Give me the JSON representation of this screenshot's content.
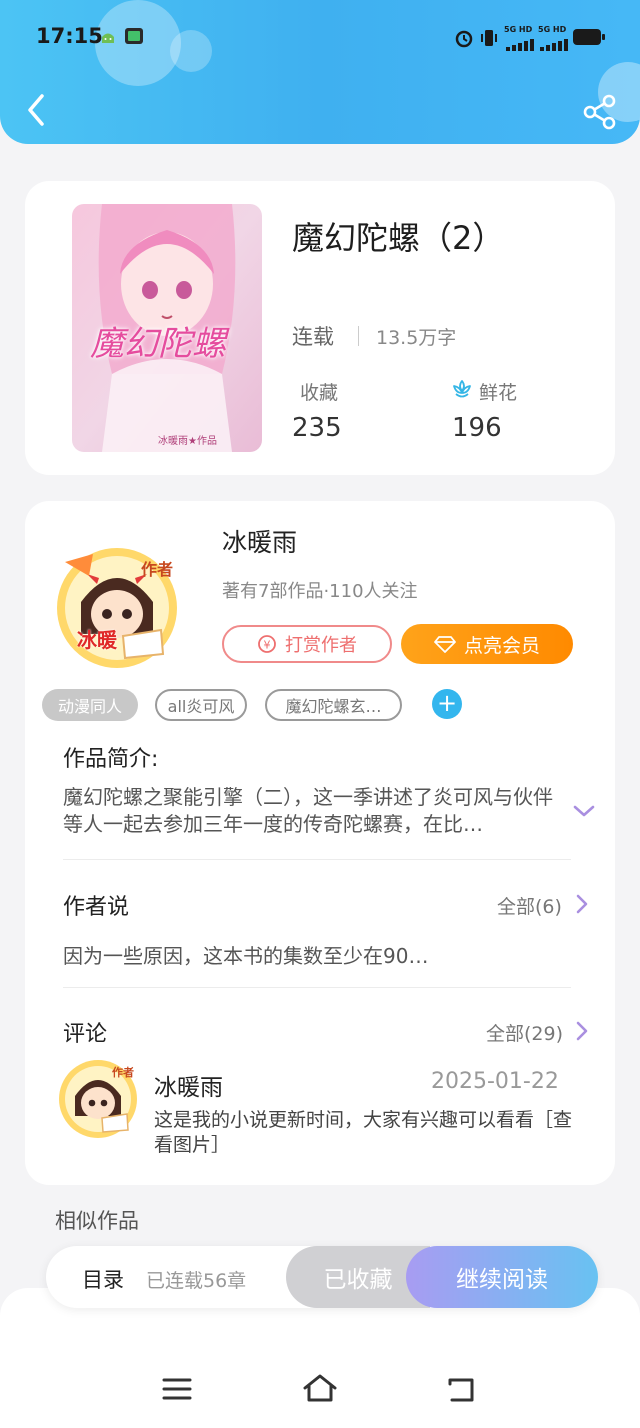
{
  "status_bar": {
    "time": "17:15",
    "net1": "5G HD",
    "net2": "5G HD"
  },
  "header": {
    "back_icon": "chevron-left-icon",
    "share_icon": "share-icon"
  },
  "book": {
    "title": "魔幻陀螺（2）",
    "status": "连载",
    "word_count": "13.5万字",
    "favorites_label": "收藏",
    "favorites_value": "235",
    "flowers_label": "鲜花",
    "flowers_value": "196",
    "cover_title": "魔幻陀螺",
    "cover_credit": "冰暖雨★作品"
  },
  "author": {
    "name": "冰暖雨",
    "meta": "著有7部作品·110人关注",
    "badge": "作者",
    "badge_name": "冰暖",
    "reward_label": "打赏作者",
    "vip_label": "点亮会员",
    "tags": [
      "动漫同人",
      "all炎可风",
      "魔幻陀螺玄…"
    ]
  },
  "intro": {
    "title": "作品简介:",
    "text": "魔幻陀螺之聚能引擎（二），这一季讲述了炎可风与伙伴等人一起去参加三年一度的传奇陀螺赛，在比…"
  },
  "author_says": {
    "title": "作者说",
    "more": "全部(6)",
    "text": "因为一些原因，这本书的集数至少在90…"
  },
  "comments": {
    "title": "评论",
    "more": "全部(29)",
    "item": {
      "name": "冰暖雨",
      "date": "2025-01-22",
      "text": "这是我的小说更新时间，大家有兴趣可以看看［查看图片］"
    }
  },
  "similar": {
    "title": "相似作品"
  },
  "action_bar": {
    "toc": "目录",
    "chapters": "已连载56章",
    "collected": "已收藏",
    "continue": "继续阅读"
  },
  "colors": {
    "header": "#3fb0f0",
    "vip": "#ff8a00",
    "reward": "#ee6f6f",
    "read_gradient_start": "#a89cf2",
    "read_gradient_end": "#68c2f2"
  }
}
